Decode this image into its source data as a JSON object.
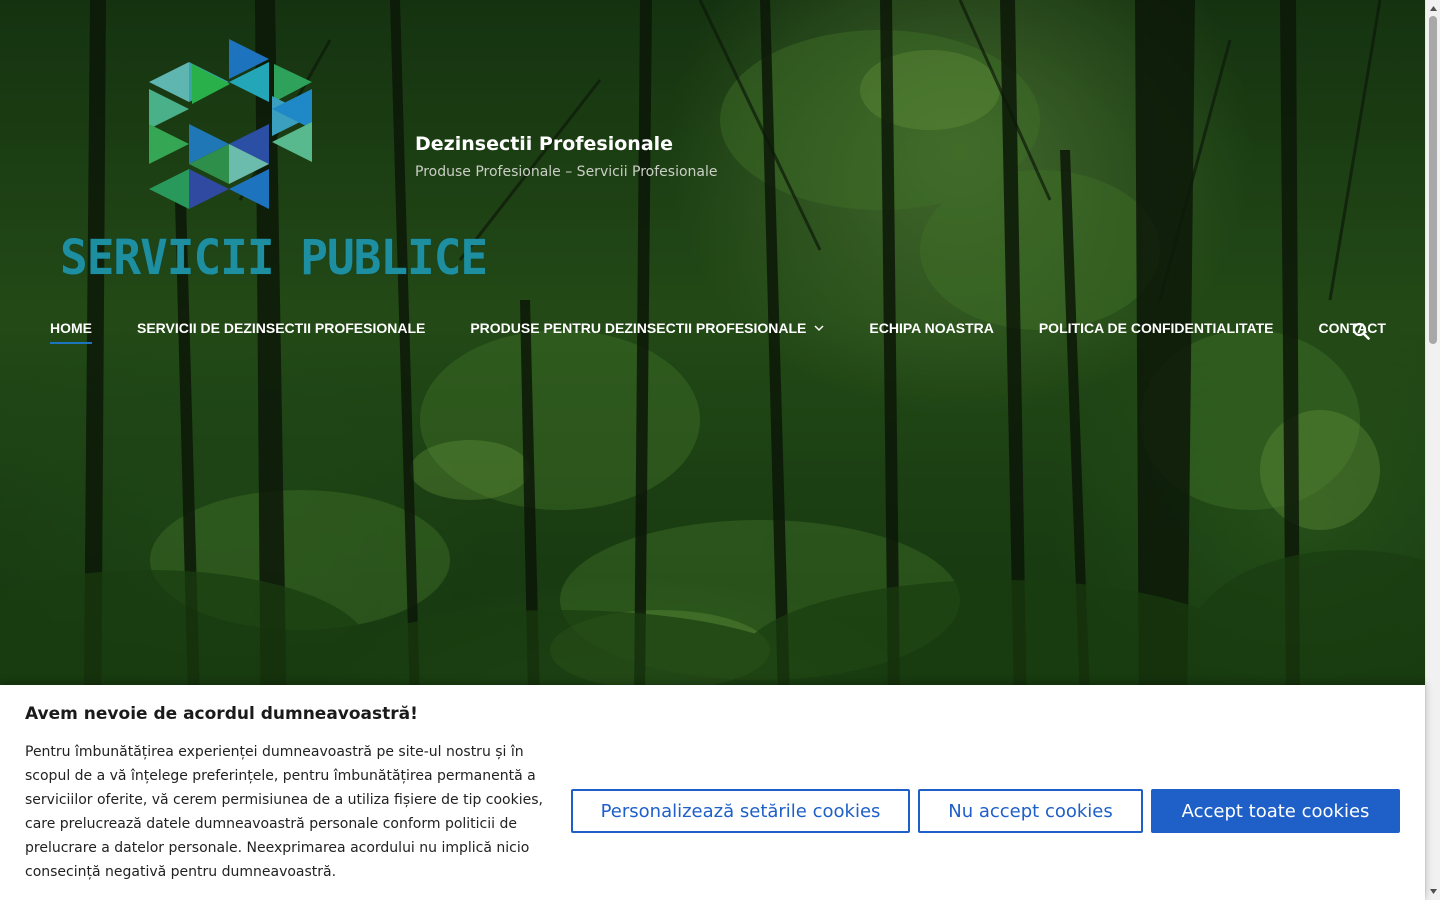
{
  "site": {
    "logo_text": "SERVICII PUBLICE",
    "title": "Dezinsectii Profesionale",
    "tagline": "Produse Profesionale – Servicii Profesionale"
  },
  "nav": {
    "items": [
      {
        "label": "HOME",
        "active": true
      },
      {
        "label": "SERVICII DE DEZINSECTII PROFESIONALE"
      },
      {
        "label": "PRODUSE PENTRU DEZINSECTII PROFESIONALE",
        "has_dropdown": true
      },
      {
        "label": "ECHIPA NOASTRA"
      },
      {
        "label": "POLITICA DE CONFIDENTIALITATE"
      },
      {
        "label": "CONTACT"
      }
    ],
    "search_icon": "search-icon",
    "active_underline_color": "#1e73be"
  },
  "cookie": {
    "title": "Avem nevoie de acordul dumneavoastră!",
    "text": "Pentru îmbunătățirea experienței dumneavoastră pe site-ul nostru și în scopul de a vă înțelege preferințele, pentru îmbunătățirea permanentă a serviciilor oferite, vă cerem permisiunea de a utiliza fișiere de tip cookies, care prelucrează datele dumneavoastră personale conform politicii de prelucrare a datelor personale. Neexprimarea acordului nu implică nicio consecință negativă pentru dumneavoastră.",
    "customize_label": "Personalizează setările cookies",
    "reject_label": "Nu accept cookies",
    "accept_label": "Accept toate cookies",
    "accent_color": "#1e5fc8"
  }
}
